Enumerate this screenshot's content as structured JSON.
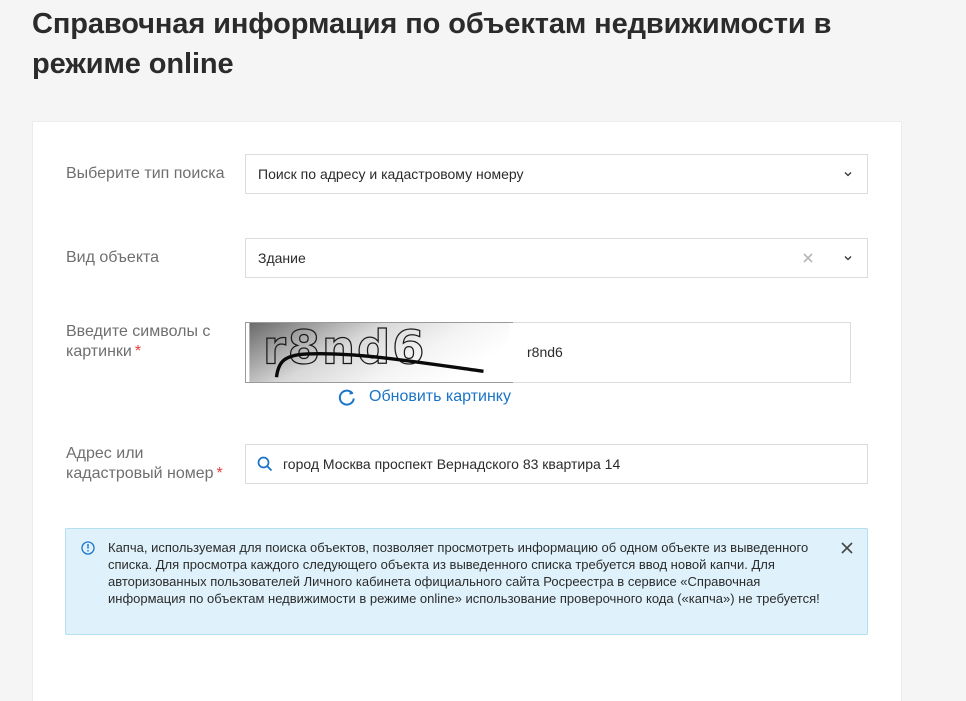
{
  "page": {
    "title": "Справочная информация по объектам недвижимости в режиме online"
  },
  "form": {
    "search_type": {
      "label": "Выберите тип поиска",
      "value": "Поиск по адресу и кадастровому номеру"
    },
    "object_type": {
      "label": "Вид объекта",
      "value": "Здание"
    },
    "captcha": {
      "label": "Введите символы с картинки",
      "required_mark": "*",
      "image_text": "r8nd6",
      "value": "r8nd6",
      "refresh_label": "Обновить картинку"
    },
    "address": {
      "label": "Адрес или кадастровый номер",
      "required_mark": "*",
      "value": "город Москва проспект Вернадского 83 квартира 14"
    }
  },
  "notice": {
    "text": "Капча, используемая для поиска объектов, позволяет просмотреть информацию об одном объекте из выведенного списка. Для просмотра каждого следующего объекта из выведенного списка требуется ввод новой капчи. Для авторизованных пользователей Личного кабинета официального сайта Росреестра в сервисе «Справочная информация по объектам недвижимости в режиме online» использование проверочного кода («капча») не требуется!"
  },
  "colors": {
    "accent": "#1a74c8",
    "required": "#e63c3c",
    "notice_bg": "#dff2fb"
  }
}
